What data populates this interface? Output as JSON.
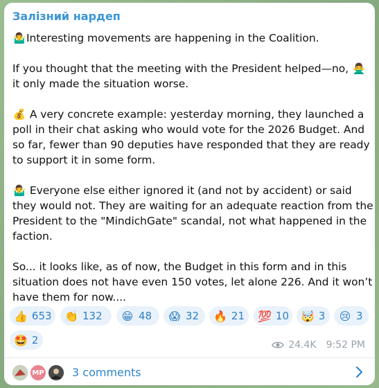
{
  "channel": {
    "name": "Залізний нардеп"
  },
  "post": {
    "lines": [
      {
        "emoji": "🤷‍♂️",
        "text": "Interesting movements are happening in the Coalition."
      },
      {
        "emoji": "",
        "text": "If you thought that the meeting with the President helped—no, ",
        "trail_emoji": "🙅‍♂️"
      },
      {
        "emoji": "",
        "text": "it only made the situation worse."
      },
      {
        "emoji": "💰",
        "text": " A very concrete example: yesterday morning, they launched a"
      },
      {
        "emoji": "",
        "text": "poll in their chat asking who would vote for the 2026 Budget. And"
      },
      {
        "emoji": "",
        "text": "so far, fewer than 90 deputies have responded that they are ready"
      },
      {
        "emoji": "",
        "text": "to support it in some form."
      },
      {
        "emoji": "🤷‍♂️",
        "text": " Everyone else either ignored it (and not by accident) or said"
      },
      {
        "emoji": "",
        "text": "they would not. They are waiting for an adequate reaction from the"
      },
      {
        "emoji": "",
        "text": "President to the \"MindichGate\" scandal, not what happened in the"
      },
      {
        "emoji": "",
        "text": "faction."
      },
      {
        "emoji": "",
        "text": "So... it looks like, as of now, the Budget in this form and in this"
      },
      {
        "emoji": "",
        "text": "situation does not have even 150 votes, let alone 226. And it won’t"
      },
      {
        "emoji": "",
        "text": "have them for now...."
      }
    ]
  },
  "reactions": [
    {
      "emoji": "👍",
      "count": "653"
    },
    {
      "emoji": "👏",
      "count": "132"
    },
    {
      "emoji": "😁",
      "count": "48"
    },
    {
      "emoji": "😱",
      "count": "32"
    },
    {
      "emoji": "🔥",
      "count": "21"
    },
    {
      "emoji": "💯",
      "count": "10"
    },
    {
      "emoji": "🤯",
      "count": "3"
    },
    {
      "emoji": "😢",
      "count": "3"
    },
    {
      "emoji": "🤩",
      "count": "2"
    }
  ],
  "meta": {
    "views": "24.4K",
    "time": "9:52 PM"
  },
  "comments": {
    "label": "3 comments",
    "avatars": [
      {
        "initials": "",
        "color": "#b8423a"
      },
      {
        "initials": "MP",
        "color": "#e9838f"
      },
      {
        "initials": "",
        "color": "#3a3a3a"
      }
    ]
  },
  "colors": {
    "accent": "#3a95d6",
    "pill_bg": "#e9f2fb",
    "meta": "#9aa3ab"
  }
}
